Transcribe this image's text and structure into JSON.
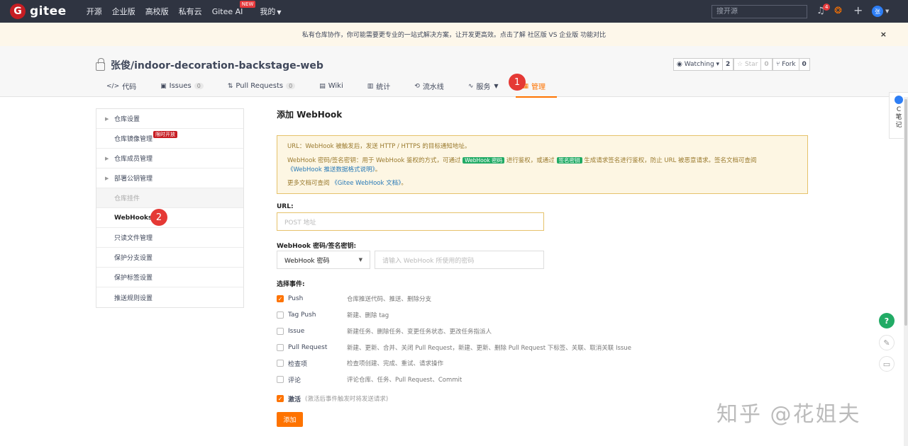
{
  "topnav": {
    "logo_letter": "G",
    "logo_text": "gitee",
    "links": [
      "开源",
      "企业版",
      "高校版",
      "私有云",
      "Gitee AI",
      "我的"
    ],
    "new_badge": "NEW",
    "search_placeholder": "搜开源",
    "notification_count": "4",
    "avatar_text": "张"
  },
  "banner": {
    "text": "私有仓库协作，你可能需要更专业的一站式解决方案，让开发更高效。点击了解 社区版 VS 企业版 功能对比",
    "close": "×"
  },
  "repo": {
    "title": "张俊/indoor-decoration-backstage-web",
    "watching_label": "Watching",
    "watching_count": "2",
    "star_label": "Star",
    "star_count": "0",
    "fork_label": "Fork",
    "fork_count": "0"
  },
  "tabs": [
    {
      "label": "代码"
    },
    {
      "label": "Issues",
      "count": "0"
    },
    {
      "label": "Pull Requests",
      "count": "0"
    },
    {
      "label": "Wiki"
    },
    {
      "label": "统计"
    },
    {
      "label": "流水线"
    },
    {
      "label": "服务"
    },
    {
      "label": "管理"
    }
  ],
  "markers": [
    "1",
    "2"
  ],
  "sidebar": {
    "items": [
      {
        "label": "仓库设置"
      },
      {
        "label": "仓库镜像管理",
        "badge": "限时开放"
      },
      {
        "label": "仓库成员管理"
      },
      {
        "label": "部署公钥管理"
      },
      {
        "label": "仓库挂件"
      },
      {
        "label": "WebHooks"
      },
      {
        "label": "只读文件管理"
      },
      {
        "label": "保护分支设置"
      },
      {
        "label": "保护标签设置"
      },
      {
        "label": "推送规则设置"
      }
    ]
  },
  "form": {
    "title": "添加 WebHook",
    "tip_url": "URL：WebHook 被触发后，发送 HTTP / HTTPS 的目标通知地址。",
    "tip_secret_a": "WebHook 密码/签名密钥：用于 WebHook 鉴权的方式，可通过",
    "tip_tag_password": "WebHook 密码",
    "tip_secret_b": "进行鉴权，或通过",
    "tip_tag_sign": "签名密钥",
    "tip_secret_c": "生成请求签名进行鉴权，防止 URL 被恶意请求。签名文档可查阅",
    "tip_secret_link": "《WebHook 推送数据格式说明》",
    "tip_secret_end": "。",
    "tip_more_a": "更多文档可查阅",
    "tip_more_link": "《Gitee WebHook 文档》",
    "tip_more_end": "。",
    "url_label": "URL:",
    "url_placeholder": "POST 地址",
    "secret_label": "WebHook 密码/签名密钥:",
    "secret_type": "WebHook 密码",
    "secret_placeholder": "请输入 WebHook 所使用的密码",
    "events_label": "选择事件:",
    "events": [
      {
        "name": "Push",
        "desc": "仓库推送代码、推送、删除分支",
        "checked": true
      },
      {
        "name": "Tag Push",
        "desc": "新建、删除 tag",
        "checked": false
      },
      {
        "name": "Issue",
        "desc": "新建任务、删除任务、变更任务状态、更改任务指派人",
        "checked": false
      },
      {
        "name": "Pull Request",
        "desc": "新建、更新、合并、关闭 Pull Request，新建、更新、删除 Pull Request 下标签、关联、取消关联 Issue",
        "checked": false
      },
      {
        "name": "检查项",
        "desc": "检查项创建、完成、重试、请求操作",
        "checked": false
      },
      {
        "name": "评论",
        "desc": "评论仓库、任务、Pull Request、Commit",
        "checked": false
      }
    ],
    "activate_label": "激活",
    "activate_hint": "(激活后事件触发时将发送请求)",
    "submit_label": "添加"
  },
  "floaters": {
    "note_text": "C\n笔\n记",
    "help": "?"
  },
  "watermark": "知乎 @花姐夫"
}
